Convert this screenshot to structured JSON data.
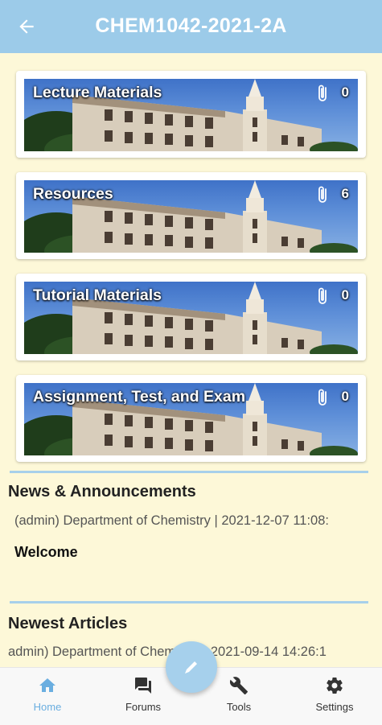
{
  "header": {
    "title": "CHEM1042-2021-2A",
    "back_icon": "arrow-left-icon"
  },
  "folders": [
    {
      "label": "Lecture Materials",
      "count": "0"
    },
    {
      "label": "Resources",
      "count": "6"
    },
    {
      "label": "Tutorial Materials",
      "count": "0"
    },
    {
      "label": "Assignment, Test, and Exam",
      "count": "0"
    }
  ],
  "news": {
    "title": "News & Announcements",
    "meta": "(admin) Department of Chemistry | 2021-12-07 11:08:",
    "headline": "Welcome"
  },
  "articles": {
    "title": "Newest Articles",
    "meta": "admin) Department of Chemistry | 2021-09-14 14:26:1"
  },
  "nav": {
    "home": "Home",
    "forums": "Forums",
    "tools": "Tools",
    "settings": "Settings"
  },
  "colors": {
    "header_bg": "#9ccbe9",
    "page_bg": "#fdf8d8",
    "accent": "#6aaee0"
  }
}
